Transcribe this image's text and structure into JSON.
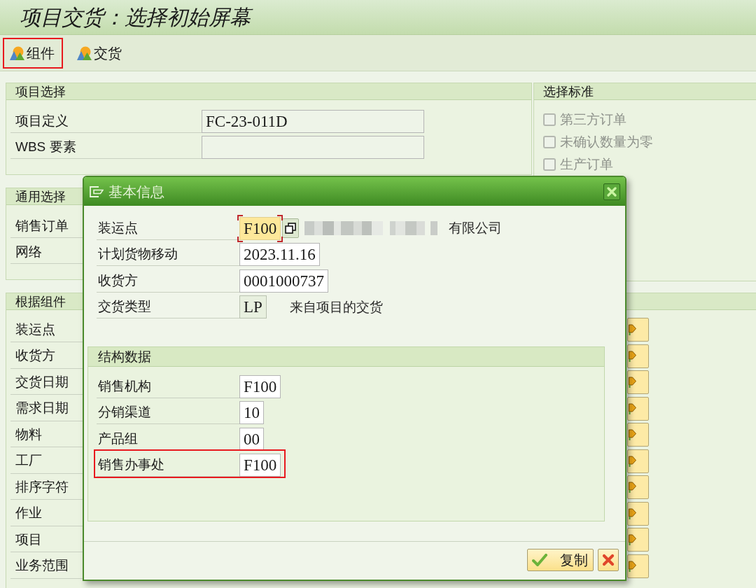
{
  "title": "项目交货：选择初始屏幕",
  "toolbar": [
    {
      "label": "组件",
      "highlighted": true
    },
    {
      "label": "交货",
      "highlighted": false
    }
  ],
  "project_selection": {
    "title": "项目选择",
    "rows": [
      {
        "label": "项目定义",
        "value": "FC-23-011D"
      },
      {
        "label": "WBS 要素"
      }
    ]
  },
  "selection_criteria": {
    "title": "选择标准",
    "options": [
      {
        "label": "第三方订单",
        "checked": false,
        "disabled": true
      },
      {
        "label": "未确认数量为零",
        "checked": false,
        "disabled": true
      },
      {
        "label": "生产订单",
        "checked": false,
        "disabled": true
      }
    ]
  },
  "general_selection": {
    "title": "通用选择",
    "rows": [
      {
        "label": "销售订单"
      },
      {
        "label": "网络"
      }
    ]
  },
  "component_selection": {
    "title": "根据组件",
    "rows": [
      {
        "label": "装运点"
      },
      {
        "label": "收货方"
      },
      {
        "label": "交货日期"
      },
      {
        "label": "需求日期"
      },
      {
        "label": "物料"
      },
      {
        "label": "工厂"
      },
      {
        "label": "排序字符"
      },
      {
        "label": "作业"
      },
      {
        "label": "项目"
      },
      {
        "label": "业务范围"
      }
    ]
  },
  "dialog": {
    "title": "基本信息",
    "fields": [
      {
        "label": "装运点",
        "value": "F100",
        "kind": "lookup",
        "focused": true,
        "blurred": true,
        "description": "有限公司"
      },
      {
        "label": "计划货物移动",
        "value": "2023.11.16",
        "kind": "input",
        "focused": false,
        "blurred": false
      },
      {
        "label": "收货方",
        "value": "0001000737",
        "kind": "input",
        "focused": false,
        "blurred": false
      },
      {
        "label": "交货类型",
        "value": "LP",
        "kind": "display",
        "focused": false,
        "blurred": false,
        "description": "来自项目的交货"
      }
    ],
    "structure": {
      "title": "结构数据",
      "fields": [
        {
          "label": "销售机构",
          "value": "F100",
          "highlighted": false
        },
        {
          "label": "分销渠道",
          "value": "10",
          "highlighted": false
        },
        {
          "label": "产品组",
          "value": "00",
          "highlighted": false
        },
        {
          "label": "销售办事处",
          "value": "F100",
          "highlighted": true
        }
      ]
    },
    "buttons": [
      {
        "kind": "confirm",
        "label": "复制"
      },
      {
        "kind": "cancel"
      }
    ]
  }
}
